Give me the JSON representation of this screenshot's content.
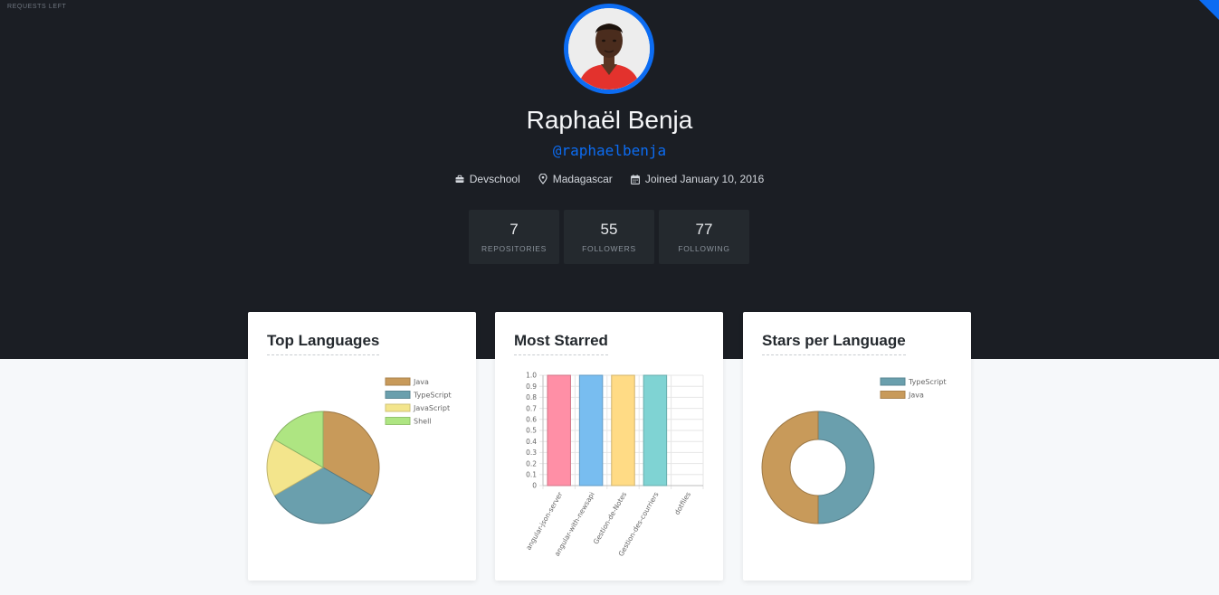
{
  "header": {
    "requests_left_label": "REQUESTS LEFT"
  },
  "profile": {
    "name": "Raphaël Benja",
    "handle": "@raphaelbenja",
    "company": "Devschool",
    "location": "Madagascar",
    "joined": "Joined January 10, 2016"
  },
  "stats": [
    {
      "value": "7",
      "label": "REPOSITORIES"
    },
    {
      "value": "55",
      "label": "FOLLOWERS"
    },
    {
      "value": "77",
      "label": "FOLLOWING"
    }
  ],
  "colors": {
    "accent": "#0c6cf2",
    "hero_bg": "#1b1e24",
    "java": "#c89a5a",
    "typescript": "#6a9fad",
    "javascript": "#f3e58c",
    "shell": "#aee582"
  },
  "icons": {
    "company": "briefcase-icon",
    "location": "map-pin-icon",
    "joined": "calendar-icon"
  },
  "cards": {
    "top_languages_title": "Top Languages",
    "most_starred_title": "Most Starred",
    "stars_per_language_title": "Stars per Language"
  },
  "chart_data": [
    {
      "type": "pie",
      "title": "Top Languages",
      "labels": [
        "Java",
        "TypeScript",
        "JavaScript",
        "Shell"
      ],
      "values": [
        3,
        3,
        1.5,
        1.5
      ],
      "colors": [
        "#c89a5a",
        "#6a9fad",
        "#f3e58c",
        "#aee582"
      ],
      "legend": "top-right"
    },
    {
      "type": "bar",
      "title": "Most Starred",
      "categories": [
        "angular-json-server",
        "angular-with-newsapi",
        "Gestion-de-Notes",
        "Gestion-des-courriers",
        "dotfiles"
      ],
      "values": [
        1,
        1,
        1,
        1,
        0
      ],
      "colors": [
        "#ff8fa6",
        "#78bdf0",
        "#ffdb85",
        "#7fd3d3",
        "#c9cbcf"
      ],
      "yticks": [
        "0",
        "0.1",
        "0.2",
        "0.3",
        "0.4",
        "0.5",
        "0.6",
        "0.7",
        "0.8",
        "0.9",
        "1.0"
      ],
      "ylim": [
        0,
        1
      ],
      "grid": true
    },
    {
      "type": "pie",
      "subtype": "doughnut",
      "title": "Stars per Language",
      "labels": [
        "TypeScript",
        "Java"
      ],
      "values": [
        2,
        2
      ],
      "colors": [
        "#6a9fad",
        "#c89a5a"
      ],
      "legend": "top-right"
    }
  ]
}
